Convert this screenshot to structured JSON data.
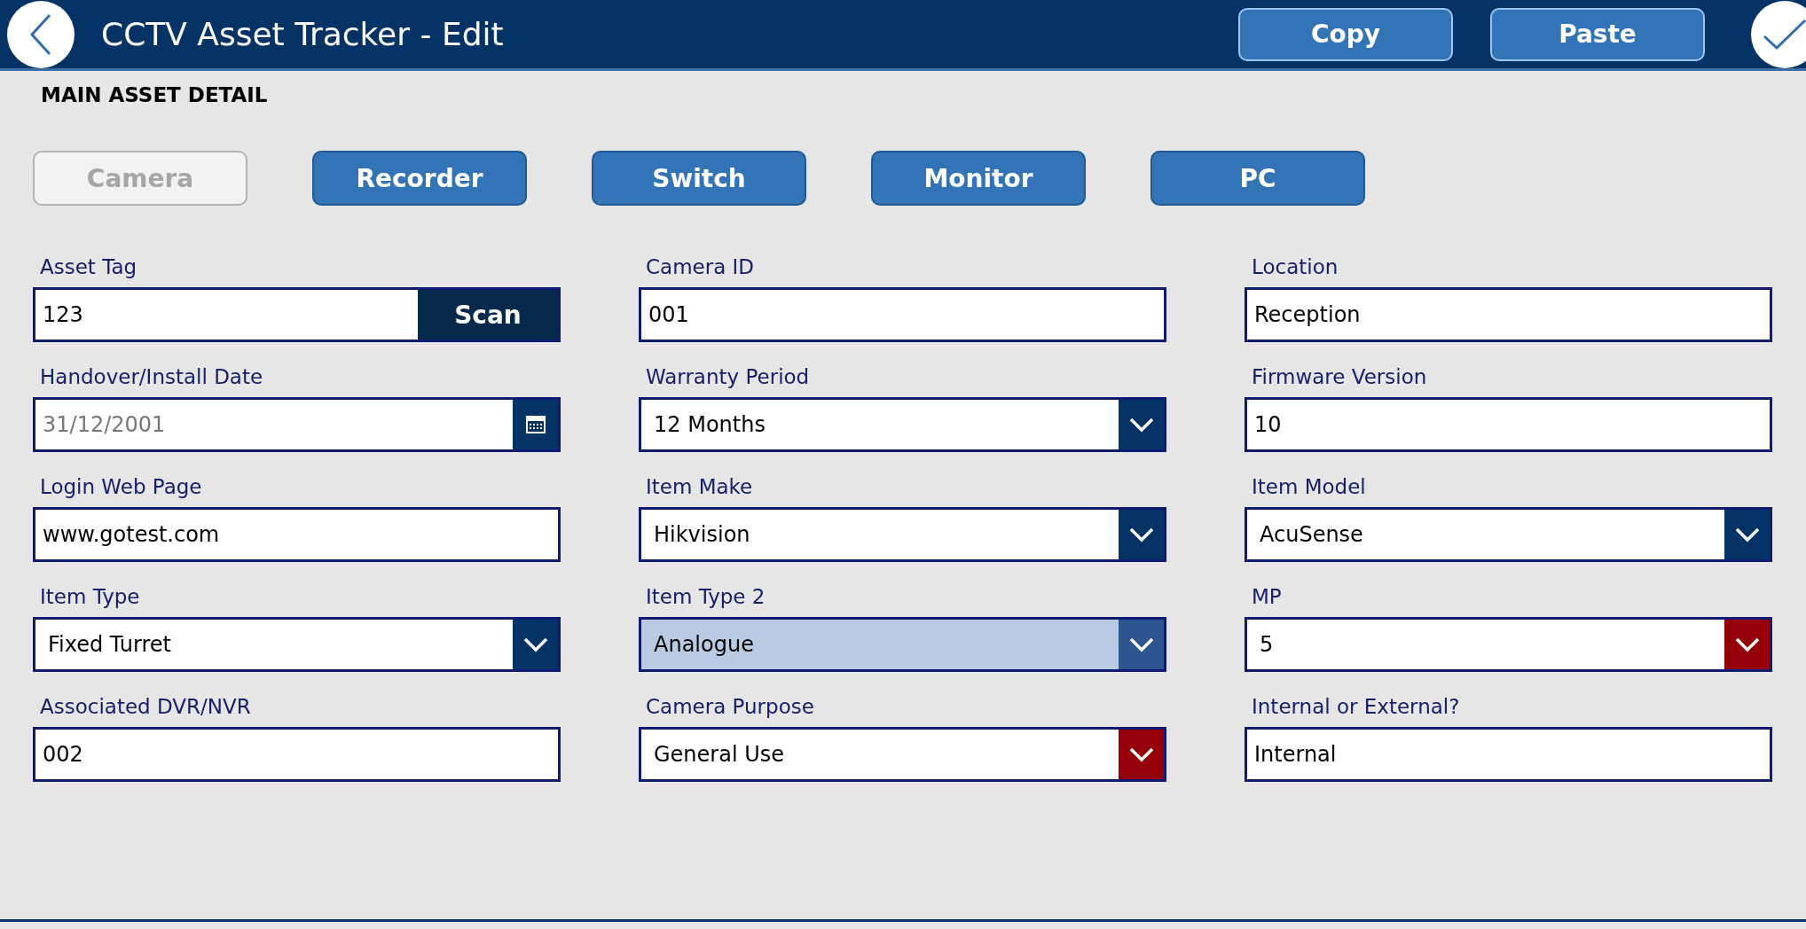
{
  "header": {
    "title": "CCTV Asset Tracker - Edit",
    "buttons": [
      "Copy",
      "Paste"
    ]
  },
  "section_title": "MAIN ASSET DETAIL",
  "asset_types": [
    {
      "label": "Camera",
      "selected": true
    },
    {
      "label": "Recorder",
      "selected": false
    },
    {
      "label": "Switch",
      "selected": false
    },
    {
      "label": "Monitor",
      "selected": false
    },
    {
      "label": "PC",
      "selected": false
    }
  ],
  "fields": [
    {
      "kind": "scan",
      "label": "Asset Tag",
      "value": "123",
      "button": "Scan"
    },
    {
      "kind": "text",
      "label": "Camera ID",
      "value": "001"
    },
    {
      "kind": "text",
      "label": "Location",
      "value": "Reception"
    },
    {
      "kind": "date",
      "label": "Handover/Install Date",
      "value": "31/12/2001",
      "disabled": true
    },
    {
      "kind": "dropdown",
      "label": "Warranty Period",
      "value": "12 Months",
      "highlighted": false,
      "alert": false
    },
    {
      "kind": "text",
      "label": "Firmware Version",
      "value": "10"
    },
    {
      "kind": "text",
      "label": "Login Web Page",
      "value": "www.gotest.com"
    },
    {
      "kind": "dropdown",
      "label": "Item Make",
      "value": "Hikvision",
      "highlighted": false,
      "alert": false
    },
    {
      "kind": "dropdown",
      "label": "Item Model",
      "value": "AcuSense",
      "highlighted": false,
      "alert": false
    },
    {
      "kind": "dropdown",
      "label": "Item Type",
      "value": "Fixed Turret",
      "highlighted": false,
      "alert": false
    },
    {
      "kind": "dropdown",
      "label": "Item Type 2",
      "value": "Analogue",
      "highlighted": true,
      "alert": false
    },
    {
      "kind": "dropdown",
      "label": "MP",
      "value": "5",
      "highlighted": false,
      "alert": true
    },
    {
      "kind": "text",
      "label": "Associated DVR/NVR",
      "value": "002"
    },
    {
      "kind": "dropdown",
      "label": "Camera Purpose",
      "value": "General Use",
      "highlighted": false,
      "alert": true
    },
    {
      "kind": "text",
      "label": "Internal or External?",
      "value": "Internal"
    }
  ]
}
